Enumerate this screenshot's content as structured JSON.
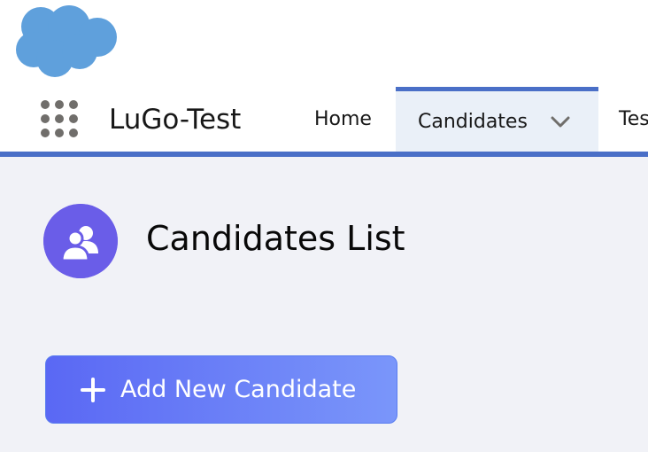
{
  "logo": {
    "icon": "salesforce-cloud-icon"
  },
  "header": {
    "app_launcher_icon": "app-launcher-grid-icon",
    "app_name": "LuGo-Test"
  },
  "nav": {
    "home_label": "Home",
    "candidates_label": "Candidates",
    "candidates_dropdown_icon": "chevron-down-icon",
    "test_label": "Tes"
  },
  "page": {
    "title": "Candidates List",
    "title_icon": "candidates-icon",
    "add_button_label": "Add New Candidate",
    "add_button_icon": "plus-icon"
  },
  "colors": {
    "brand_blue": "#4a6fc7",
    "icon_purple": "#6a5de8",
    "button_start": "#5a68f4",
    "button_end": "#7a96fa",
    "page_bg": "#f1f2f7"
  }
}
